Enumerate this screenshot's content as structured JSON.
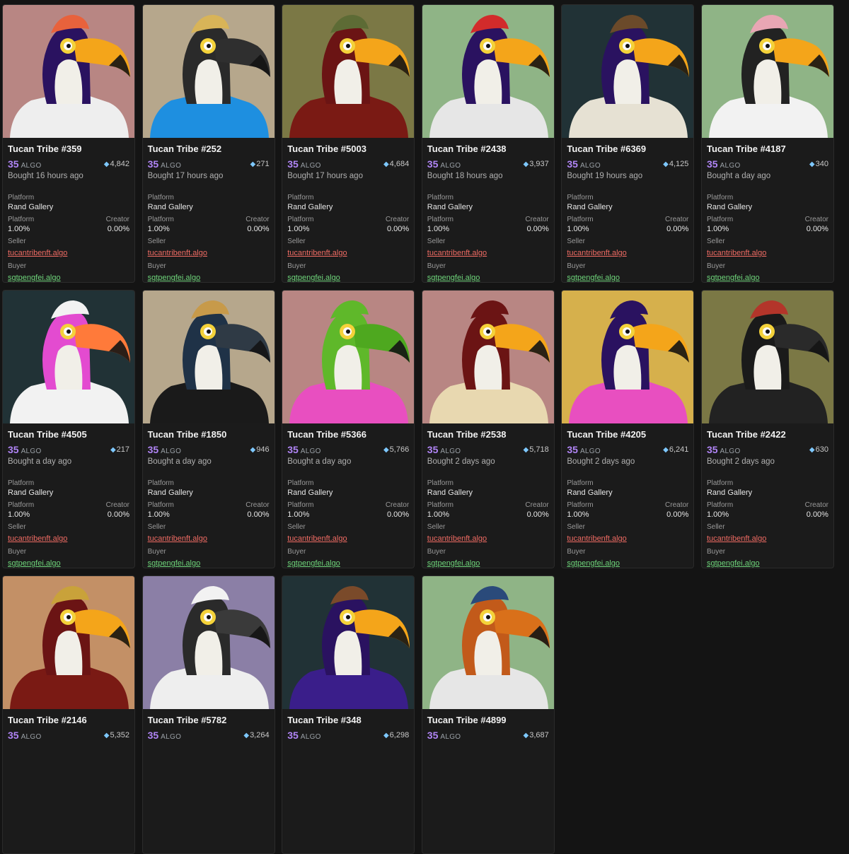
{
  "labels": {
    "platform": "Platform",
    "creator": "Creator",
    "seller": "Seller",
    "buyer": "Buyer",
    "currency": "ALGO"
  },
  "cards": [
    {
      "name": "Tucan Tribe #359",
      "price": "35",
      "rank": "4,842",
      "time": "Bought 16 hours ago",
      "platform": "Rand Gallery",
      "platform_fee": "1.00%",
      "creator_fee": "0.00%",
      "seller": "tucantribenft.algo",
      "buyer": "sgtpengfei.algo",
      "bg": "#b88683",
      "body": "#2a1260",
      "beak": "#f4a51a",
      "shirt": "#eeeeee",
      "hat": "#e8623c"
    },
    {
      "name": "Tucan Tribe #252",
      "price": "35",
      "rank": "271",
      "time": "Bought 17 hours ago",
      "platform": "Rand Gallery",
      "platform_fee": "1.00%",
      "creator_fee": "0.00%",
      "seller": "tucantribenft.algo",
      "buyer": "sgtpengfei.algo",
      "bg": "#b6a78c",
      "body": "#2a2a2a",
      "beak": "#2f2f2f",
      "shirt": "#1e8fe0",
      "hat": "#d8b458"
    },
    {
      "name": "Tucan Tribe #5003",
      "price": "35",
      "rank": "4,684",
      "time": "Bought 17 hours ago",
      "platform": "Rand Gallery",
      "platform_fee": "1.00%",
      "creator_fee": "0.00%",
      "seller": "tucantribenft.algo",
      "buyer": "sgtpengfei.algo",
      "bg": "#7b7845",
      "body": "#6b1414",
      "beak": "#f4a51a",
      "shirt": "#7a1a14",
      "hat": "#5d6b35"
    },
    {
      "name": "Tucan Tribe #2438",
      "price": "35",
      "rank": "3,937",
      "time": "Bought 18 hours ago",
      "platform": "Rand Gallery",
      "platform_fee": "1.00%",
      "creator_fee": "0.00%",
      "seller": "tucantribenft.algo",
      "buyer": "sgtpengfei.algo",
      "bg": "#8fb486",
      "body": "#2a1260",
      "beak": "#f4a51a",
      "shirt": "#e6e6e6",
      "hat": "#d22b2b"
    },
    {
      "name": "Tucan Tribe #6369",
      "price": "35",
      "rank": "4,125",
      "time": "Bought 19 hours ago",
      "platform": "Rand Gallery",
      "platform_fee": "1.00%",
      "creator_fee": "0.00%",
      "seller": "tucantribenft.algo",
      "buyer": "sgtpengfei.algo",
      "bg": "#213236",
      "body": "#2a1260",
      "beak": "#f4a51a",
      "shirt": "#e6e1d3",
      "hat": "#6b4a2a"
    },
    {
      "name": "Tucan Tribe #4187",
      "price": "35",
      "rank": "340",
      "time": "Bought a day ago",
      "platform": "Rand Gallery",
      "platform_fee": "1.00%",
      "creator_fee": "0.00%",
      "seller": "tucantribenft.algo",
      "buyer": "sgtpengfei.algo",
      "bg": "#8fb486",
      "body": "#222222",
      "beak": "#f4a51a",
      "shirt": "#f2f2f2",
      "hat": "#e8a6b4"
    },
    {
      "name": "Tucan Tribe #4505",
      "price": "35",
      "rank": "217",
      "time": "Bought a day ago",
      "platform": "Rand Gallery",
      "platform_fee": "1.00%",
      "creator_fee": "0.00%",
      "seller": "tucantribenft.algo",
      "buyer": "sgtpengfei.algo",
      "bg": "#213236",
      "body": "#e34bd0",
      "beak": "#ff7a3a",
      "shirt": "#f2f2f2",
      "hat": "#f2f2f2"
    },
    {
      "name": "Tucan Tribe #1850",
      "price": "35",
      "rank": "946",
      "time": "Bought a day ago",
      "platform": "Rand Gallery",
      "platform_fee": "1.00%",
      "creator_fee": "0.00%",
      "seller": "tucantribenft.algo",
      "buyer": "sgtpengfei.algo",
      "bg": "#b6a78c",
      "body": "#1f3247",
      "beak": "#2f3a45",
      "shirt": "#1a1a1a",
      "hat": "#c79a4a"
    },
    {
      "name": "Tucan Tribe #5366",
      "price": "35",
      "rank": "5,766",
      "time": "Bought a day ago",
      "platform": "Rand Gallery",
      "platform_fee": "1.00%",
      "creator_fee": "0.00%",
      "seller": "tucantribenft.algo",
      "buyer": "sgtpengfei.algo",
      "bg": "#b88683",
      "body": "#5fb82a",
      "beak": "#4ea81f",
      "shirt": "#e84fc0",
      "hat": "#5fb82a"
    },
    {
      "name": "Tucan Tribe #2538",
      "price": "35",
      "rank": "5,718",
      "time": "Bought 2 days ago",
      "platform": "Rand Gallery",
      "platform_fee": "1.00%",
      "creator_fee": "0.00%",
      "seller": "tucantribenft.algo",
      "buyer": "sgtpengfei.algo",
      "bg": "#b88683",
      "body": "#6b1414",
      "beak": "#f4a51a",
      "shirt": "#e8d8b0",
      "hat": "#6b1414"
    },
    {
      "name": "Tucan Tribe #4205",
      "price": "35",
      "rank": "6,241",
      "time": "Bought 2 days ago",
      "platform": "Rand Gallery",
      "platform_fee": "1.00%",
      "creator_fee": "0.00%",
      "seller": "tucantribenft.algo",
      "buyer": "sgtpengfei.algo",
      "bg": "#d6b04c",
      "body": "#2a1260",
      "beak": "#f4a51a",
      "shirt": "#e84fc0",
      "hat": "#2a1260"
    },
    {
      "name": "Tucan Tribe #2422",
      "price": "35",
      "rank": "630",
      "time": "Bought 2 days ago",
      "platform": "Rand Gallery",
      "platform_fee": "1.00%",
      "creator_fee": "0.00%",
      "seller": "tucantribenft.algo",
      "buyer": "sgtpengfei.algo",
      "bg": "#7b7845",
      "body": "#1a1a1a",
      "beak": "#2a2a2a",
      "shirt": "#222222",
      "hat": "#b3352a"
    },
    {
      "name": "Tucan Tribe #2146",
      "price": "35",
      "rank": "5,352",
      "time": "",
      "platform": "",
      "platform_fee": "",
      "creator_fee": "",
      "seller": "",
      "buyer": "",
      "bg": "#c39066",
      "body": "#6b1414",
      "beak": "#f4a51a",
      "shirt": "#7a1a14",
      "hat": "#c9a23a"
    },
    {
      "name": "Tucan Tribe #5782",
      "price": "35",
      "rank": "3,264",
      "time": "",
      "platform": "",
      "platform_fee": "",
      "creator_fee": "",
      "seller": "",
      "buyer": "",
      "bg": "#8b7fa6",
      "body": "#2a2a2a",
      "beak": "#3a3a3a",
      "shirt": "#eeeeee",
      "hat": "#f2f2f2"
    },
    {
      "name": "Tucan Tribe #348",
      "price": "35",
      "rank": "6,298",
      "time": "",
      "platform": "",
      "platform_fee": "",
      "creator_fee": "",
      "seller": "",
      "buyer": "",
      "bg": "#213236",
      "body": "#2a1260",
      "beak": "#f4a51a",
      "shirt": "#3a1e8a",
      "hat": "#7a4a2a"
    },
    {
      "name": "Tucan Tribe #4899",
      "price": "35",
      "rank": "3,687",
      "time": "",
      "platform": "",
      "platform_fee": "",
      "creator_fee": "",
      "seller": "",
      "buyer": "",
      "bg": "#8fb486",
      "body": "#c25a1a",
      "beak": "#d9701a",
      "shirt": "#e6e6e6",
      "hat": "#2a4a7a"
    }
  ]
}
